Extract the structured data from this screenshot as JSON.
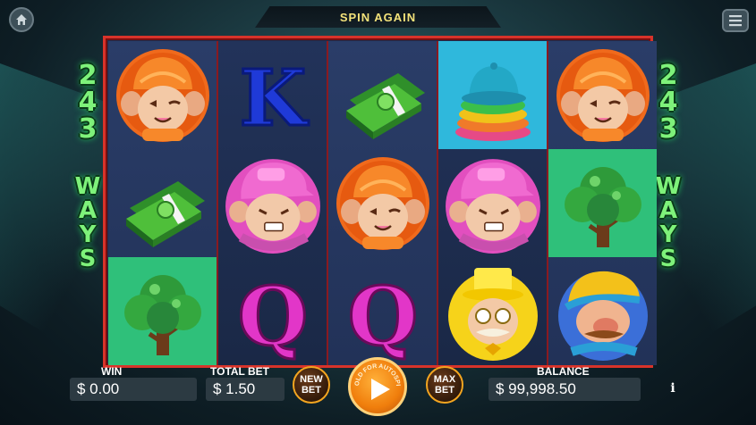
{
  "header": {
    "banner_text": "SPIN AGAIN",
    "home_icon": "home-icon",
    "menu_icon": "hamburger-menu-icon"
  },
  "ways": {
    "number": [
      "2",
      "4",
      "3"
    ],
    "word": [
      "W",
      "A",
      "Y",
      "S"
    ]
  },
  "reels": [
    [
      "orange-monkey-symbol",
      "cash-stack-symbol",
      "tree-symbol"
    ],
    [
      "letter-k-symbol",
      "pink-cap-monkey-symbol",
      "letter-q-symbol"
    ],
    [
      "cash-stack-symbol",
      "orange-monkey-symbol",
      "letter-q-symbol"
    ],
    [
      "hat-stack-symbol",
      "pink-cap-monkey-symbol",
      "yellow-hat-grandpa-symbol"
    ],
    [
      "orange-monkey-symbol",
      "tree-symbol",
      "blue-cap-grandpa-symbol"
    ]
  ],
  "symbol_labels": {
    "k": "K",
    "q": "Q"
  },
  "bottom": {
    "win_label": "WIN",
    "win_value": "$ 0.00",
    "total_bet_label": "TOTAL BET",
    "total_bet_value": "$ 1.50",
    "new_bet_line1": "NEW",
    "new_bet_line2": "BET",
    "spin_arc_text": "HOLD FOR AUTOSPIN",
    "max_bet_line1": "MAX",
    "max_bet_line2": "BET",
    "balance_label": "BALANCE",
    "balance_value": "$ 99,998.50",
    "info_label": "i"
  },
  "colors": {
    "reel_border": "#d8332a",
    "ways_text": "#7ef27a",
    "banner_text": "#f3e27a",
    "button_ring": "#f3a520",
    "spin_button": "#f07e0c"
  }
}
